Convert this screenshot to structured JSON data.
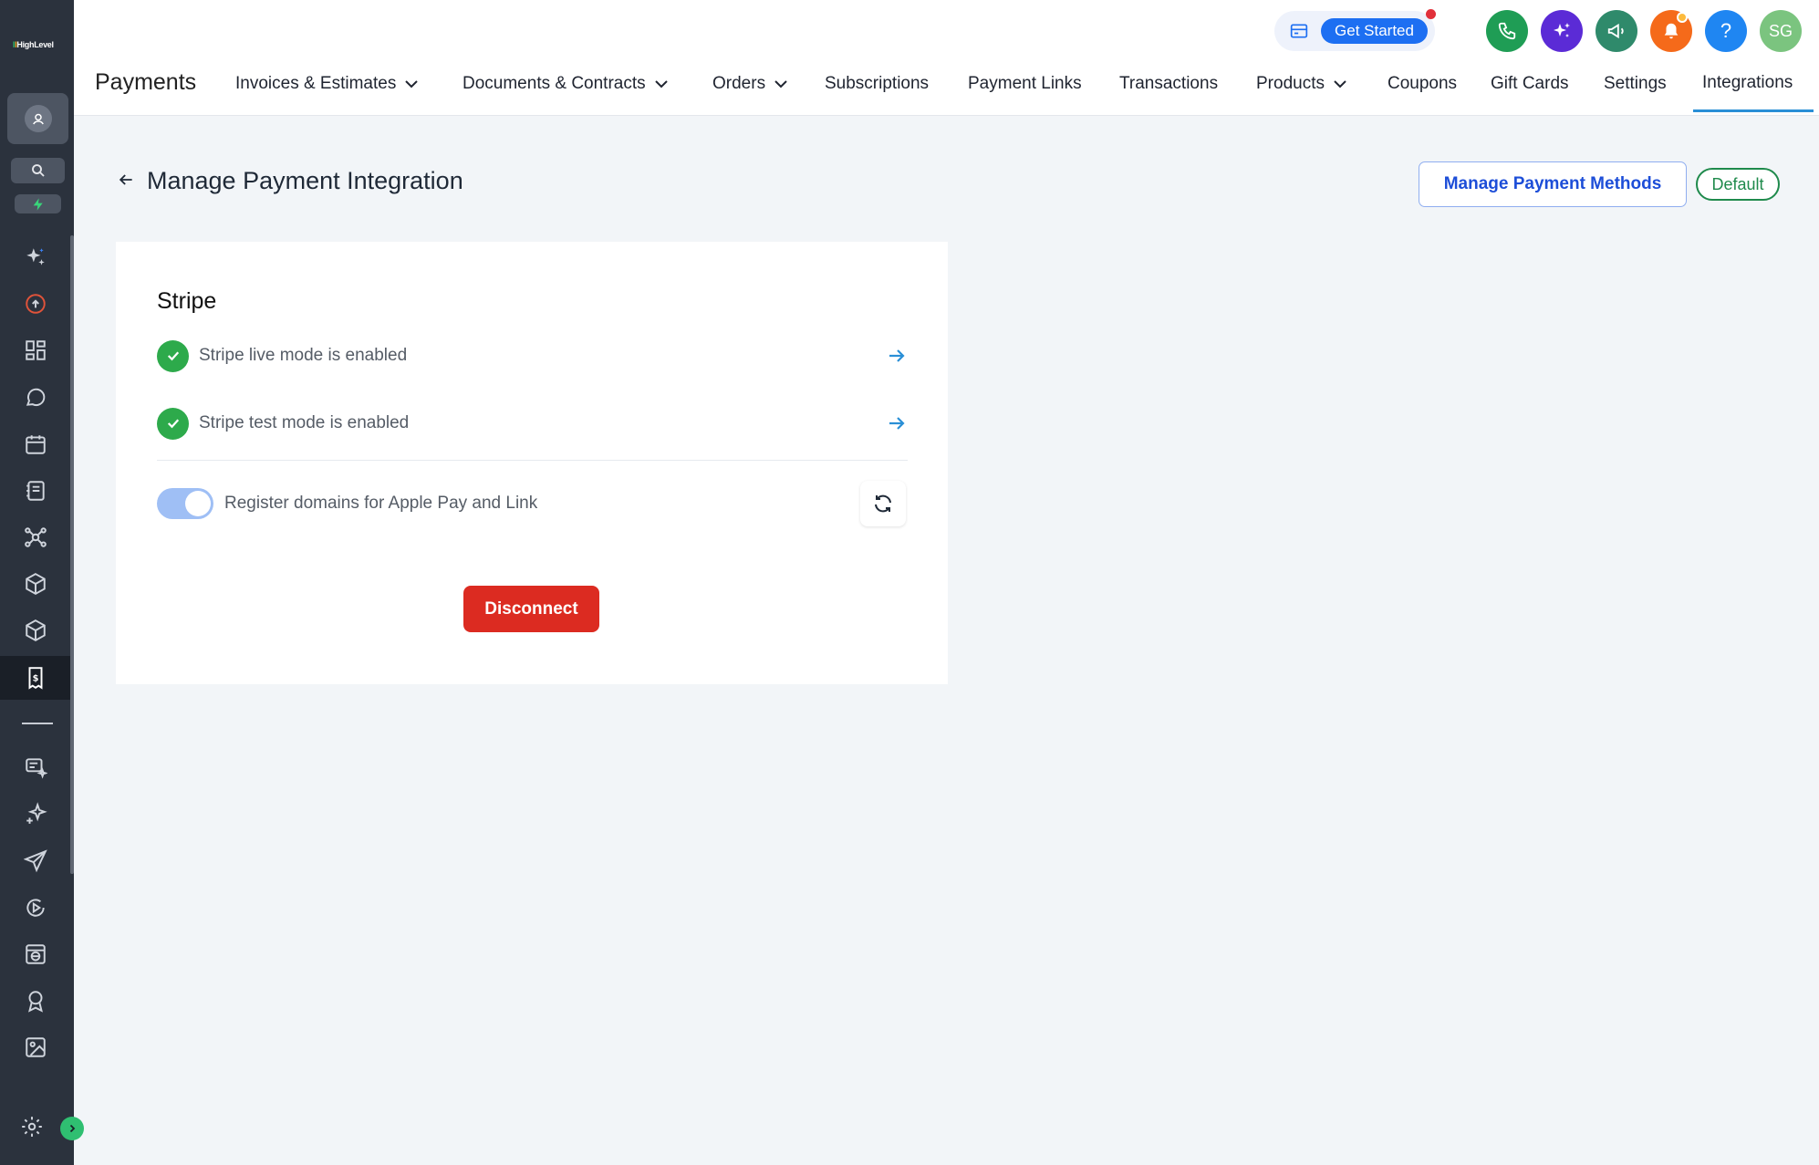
{
  "sidebar": {
    "logo": "HighLevel",
    "items": [
      {
        "icon": "sparkle-icon"
      },
      {
        "icon": "upload-cloud-icon"
      },
      {
        "icon": "dashboard-grid-icon"
      },
      {
        "icon": "chat-bubble-icon"
      },
      {
        "icon": "calendar-icon"
      },
      {
        "icon": "contacts-book-icon"
      },
      {
        "icon": "network-icon"
      },
      {
        "icon": "cube-icon"
      },
      {
        "icon": "cube-outline-icon"
      },
      {
        "icon": "payments-icon"
      },
      {
        "icon": "message-sparkle-icon"
      },
      {
        "icon": "ai-sparkle-icon"
      },
      {
        "icon": "send-icon"
      },
      {
        "icon": "play-circle-icon"
      },
      {
        "icon": "website-icon"
      },
      {
        "icon": "award-icon"
      },
      {
        "icon": "image-icon"
      },
      {
        "icon": "settings-icon"
      }
    ]
  },
  "header": {
    "get_started_label": "Get Started",
    "avatar_initials": "SG",
    "help_label": "?",
    "colors": {
      "phone": "#1f9d55",
      "ai": "#5b2bd6",
      "announce": "#2f8a6b",
      "notifications": "#f56a1a",
      "help": "#1f86f2",
      "avatar": "#7bc47f"
    }
  },
  "app_title": "Payments",
  "nav": [
    {
      "label": "Invoices & Estimates",
      "has_dropdown": true
    },
    {
      "label": "Documents & Contracts",
      "has_dropdown": true
    },
    {
      "label": "Orders",
      "has_dropdown": true
    },
    {
      "label": "Subscriptions",
      "has_dropdown": false
    },
    {
      "label": "Payment Links",
      "has_dropdown": false
    },
    {
      "label": "Transactions",
      "has_dropdown": false
    },
    {
      "label": "Products",
      "has_dropdown": true
    },
    {
      "label": "Coupons",
      "has_dropdown": false
    },
    {
      "label": "Gift Cards",
      "has_dropdown": false
    },
    {
      "label": "Settings",
      "has_dropdown": false
    },
    {
      "label": "Integrations",
      "has_dropdown": false,
      "active": true
    }
  ],
  "page": {
    "title": "Manage Payment Integration",
    "manage_methods_label": "Manage Payment Methods",
    "default_badge": "Default"
  },
  "card": {
    "title": "Stripe",
    "rows": [
      {
        "label": "Stripe live mode is enabled",
        "status": "enabled"
      },
      {
        "label": "Stripe test mode is enabled",
        "status": "enabled"
      }
    ],
    "toggle": {
      "label": "Register domains for Apple Pay and Link",
      "on": true
    },
    "disconnect_label": "Disconnect"
  }
}
